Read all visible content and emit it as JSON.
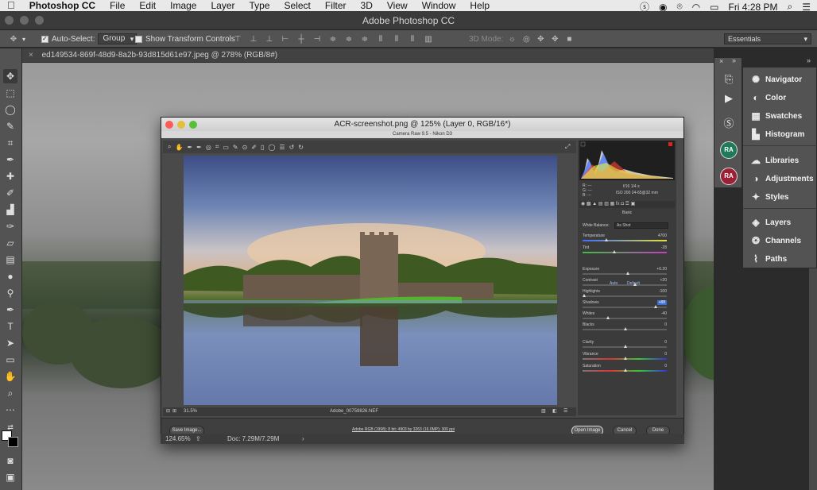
{
  "menubar": {
    "apple": "",
    "app": "Photoshop CC",
    "items": [
      "File",
      "Edit",
      "Image",
      "Layer",
      "Type",
      "Select",
      "Filter",
      "3D",
      "View",
      "Window",
      "Help"
    ],
    "clock": "Fri 4:28 PM"
  },
  "window": {
    "title": "Adobe Photoshop CC"
  },
  "options": {
    "auto_select_label": "Auto-Select:",
    "auto_select_value": "Group",
    "show_transform_label": "Show Transform Controls",
    "mode_3d_label": "3D Mode:",
    "workspace": "Essentials"
  },
  "document": {
    "tab_title": "ed149534-869f-48d9-8a2b-93d815d61e97.jpeg @ 278% (RGB/8#)"
  },
  "right_panel": {
    "items": [
      "Navigator",
      "Color",
      "Swatches",
      "Histogram",
      "Libraries",
      "Adjustments",
      "Styles",
      "Layers",
      "Channels",
      "Paths"
    ],
    "avatars": [
      "RA",
      "RA"
    ]
  },
  "acr": {
    "window_title": "ACR-screenshot.png @ 125% (Layer 0, RGB/16*)",
    "subtitle": "Camera Raw 9.5 - Nikon D3",
    "camera_info": {
      "rgb": [
        "R: ---",
        "G: ---",
        "B: ---"
      ],
      "line1": "f/16   1/4 s",
      "line2": "ISO 200   24-65@32 mm"
    },
    "panel_title": "Basic",
    "white_balance_label": "White Balance:",
    "white_balance_value": "As Shot",
    "auto_label": "Auto",
    "default_label": "Default",
    "sliders": [
      {
        "label": "Temperature",
        "value": "4700"
      },
      {
        "label": "Tint",
        "value": "-28"
      },
      {
        "label": "Exposure",
        "value": "+0.20"
      },
      {
        "label": "Contrast",
        "value": "+20"
      },
      {
        "label": "Highlights",
        "value": "-100"
      },
      {
        "label": "Shadows",
        "value": "+88"
      },
      {
        "label": "Whites",
        "value": "-40"
      },
      {
        "label": "Blacks",
        "value": "0"
      },
      {
        "label": "Clarity",
        "value": "0"
      },
      {
        "label": "Vibrance",
        "value": "0"
      },
      {
        "label": "Saturation",
        "value": "0"
      }
    ],
    "zoom": "31.5%",
    "filename": "Adobe_00759826.NEF",
    "workflow_link": "Adobe RGB (1998); 8 bit; 4903 by 3263 (16.0MP); 300 ppi",
    "buttons": {
      "save": "Save Image...",
      "open": "Open Image",
      "cancel": "Cancel",
      "done": "Done"
    }
  },
  "status": {
    "zoom": "124.65%",
    "doc": "Doc: 7.29M/7.29M"
  },
  "colors": {
    "accent_blue": "#3b6fd6",
    "avatar1": "#1f7a5a",
    "avatar2": "#9b1f35"
  }
}
